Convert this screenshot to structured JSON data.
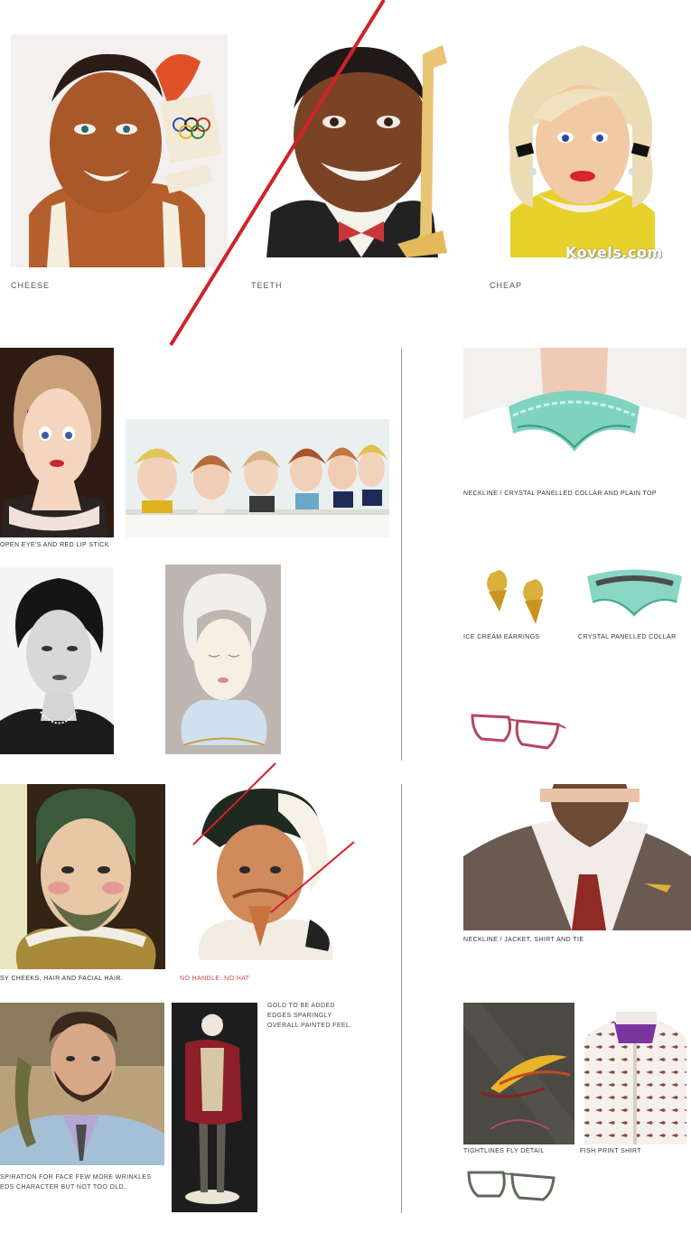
{
  "top_row": {
    "labels": [
      "CHEESE",
      "TEETH",
      "CHEAP"
    ],
    "watermark": "Kovels.com"
  },
  "left_section1": {
    "caption1": "OPEN EYE'S AND RED LIP STICK"
  },
  "right_section1": {
    "collar_caption": "NECKLINE / CRYSTAL PANELLED COLLAR AND PLAIN TOP",
    "earrings_caption": "ICE CREAM EARRINGS",
    "collar2_caption": "CRYSTAL PANELLED COLLAR"
  },
  "left_section2": {
    "caption_cheeks": "SY CHEEKS, HAIR AND FACIAL HAIR.",
    "caption_nohandle": "NO HANDLE. NO HAT",
    "gold_note": [
      "GOLD TO BE ADDED",
      "EDGES SPARINGLY",
      "OVERALL PAINTED FEEL."
    ],
    "inspiration_note": [
      "SPIRATION FOR FACE FEW MORE WRINKLES",
      "EDS CHARACTER BUT NOT TOO OLD."
    ]
  },
  "right_section2": {
    "neckline_caption": "NECKLINE / JACKET, SHIRT AND TIE",
    "fly_caption": "TIGHTLINES FLY DETAIL",
    "shirt_caption": "FISH PRINT SHIRT"
  },
  "colors": {
    "accent_red": "#d0222a",
    "label_grey": "#555555"
  }
}
